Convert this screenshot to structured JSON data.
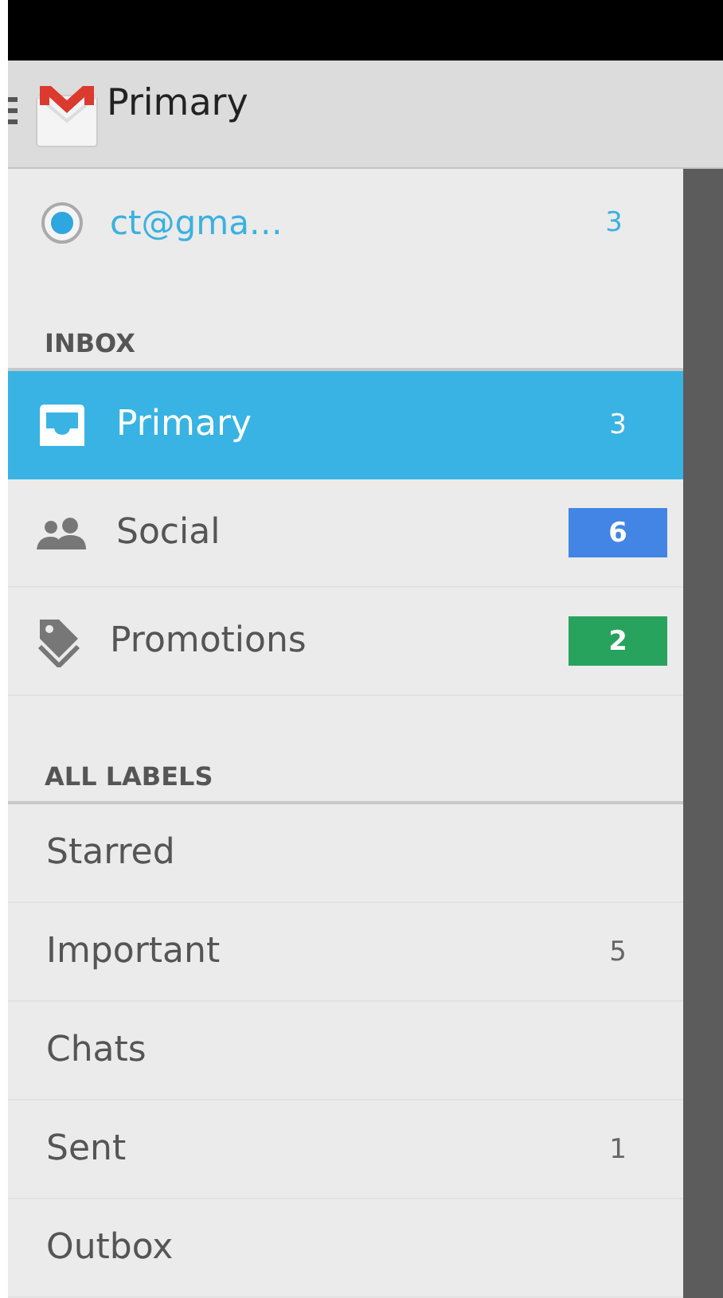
{
  "app_bar": {
    "title": "Primary"
  },
  "account": {
    "email": "ct@gma…",
    "count": "3",
    "selected": true
  },
  "inbox": {
    "heading": "INBOX",
    "items": [
      {
        "label": "Primary",
        "count": "3",
        "kind": "plain",
        "selected": true
      },
      {
        "label": "Social",
        "count": "6",
        "kind": "badge",
        "color": "#4285e4",
        "selected": false
      },
      {
        "label": "Promotions",
        "count": "2",
        "kind": "badge",
        "color": "#27a35e",
        "selected": false
      }
    ]
  },
  "labels": {
    "heading": "ALL LABELS",
    "items": [
      {
        "label": "Starred"
      },
      {
        "label": "Important",
        "count": "5"
      },
      {
        "label": "Chats"
      },
      {
        "label": "Sent",
        "count": "1"
      },
      {
        "label": "Outbox"
      }
    ]
  }
}
